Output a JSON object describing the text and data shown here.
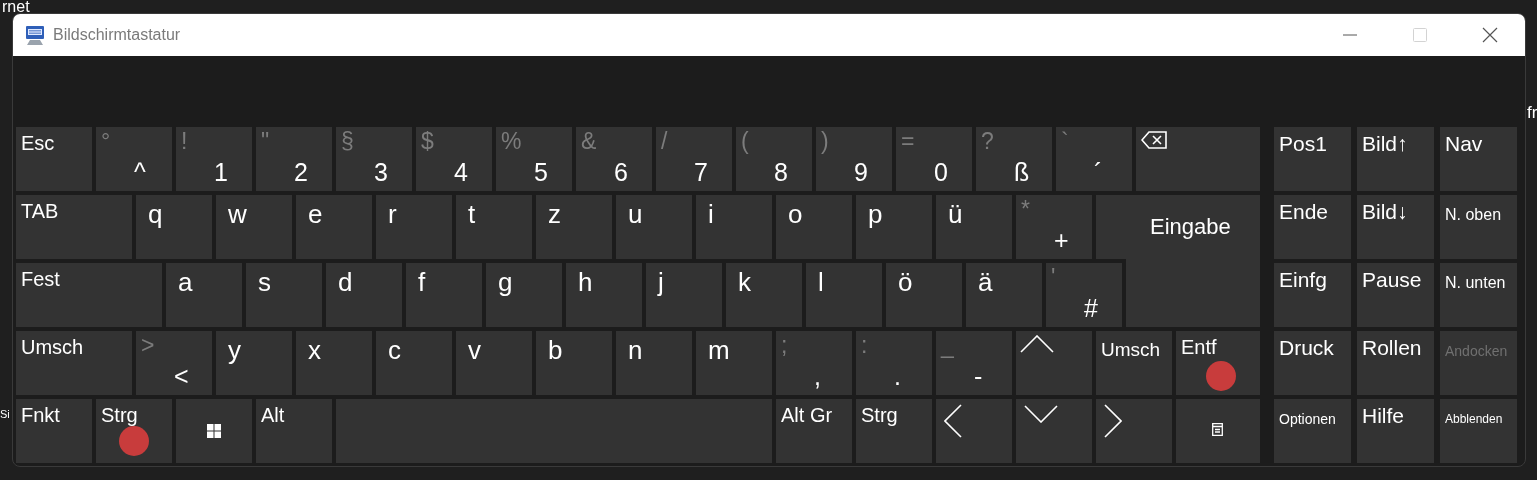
{
  "background_fragments": [
    "rnet",
    "Si",
    "fr"
  ],
  "window": {
    "title": "Bildschirmtastatur",
    "maximize_disabled": true
  },
  "keyboard": {
    "rows": [
      {
        "keys": [
          {
            "label": "Esc",
            "kind": "mod",
            "marked": false
          },
          {
            "shift": "°",
            "label": "^",
            "kind": "char",
            "marked": false
          },
          {
            "shift": "!",
            "label": "1",
            "kind": "char",
            "marked": false
          },
          {
            "shift": "\"",
            "label": "2",
            "kind": "char",
            "marked": false
          },
          {
            "shift": "§",
            "label": "3",
            "kind": "char",
            "marked": false
          },
          {
            "shift": "$",
            "label": "4",
            "kind": "char",
            "marked": false
          },
          {
            "shift": "%",
            "label": "5",
            "kind": "char",
            "marked": false
          },
          {
            "shift": "&",
            "label": "6",
            "kind": "char",
            "marked": false
          },
          {
            "shift": "/",
            "label": "7",
            "kind": "char",
            "marked": false
          },
          {
            "shift": "(",
            "label": "8",
            "kind": "char",
            "marked": false
          },
          {
            "shift": ")",
            "label": "9",
            "kind": "char",
            "marked": false
          },
          {
            "shift": "=",
            "label": "0",
            "kind": "char",
            "marked": false
          },
          {
            "shift": "?",
            "label": "ß",
            "kind": "char",
            "marked": false
          },
          {
            "shift": "`",
            "label": "´",
            "kind": "char",
            "marked": false
          },
          {
            "kind": "backspace",
            "marked": false
          }
        ]
      },
      {
        "keys": [
          {
            "label": "TAB",
            "kind": "tab",
            "marked": false
          },
          {
            "label": "q",
            "kind": "char",
            "marked": false
          },
          {
            "label": "w",
            "kind": "char",
            "marked": false
          },
          {
            "label": "e",
            "kind": "char",
            "marked": false
          },
          {
            "label": "r",
            "kind": "char",
            "marked": false
          },
          {
            "label": "t",
            "kind": "char",
            "marked": false
          },
          {
            "label": "z",
            "kind": "char",
            "marked": false
          },
          {
            "label": "u",
            "kind": "char",
            "marked": false
          },
          {
            "label": "i",
            "kind": "char",
            "marked": false
          },
          {
            "label": "o",
            "kind": "char",
            "marked": false
          },
          {
            "label": "p",
            "kind": "char",
            "marked": false
          },
          {
            "label": "ü",
            "kind": "char",
            "marked": false
          },
          {
            "shift": "*",
            "label": "+",
            "kind": "char",
            "marked": false
          },
          {
            "label": "Eingabe",
            "kind": "enter",
            "marked": false
          }
        ]
      },
      {
        "keys": [
          {
            "label": "Fest",
            "kind": "caps",
            "marked": false
          },
          {
            "label": "a",
            "kind": "char",
            "marked": false
          },
          {
            "label": "s",
            "kind": "char",
            "marked": false
          },
          {
            "label": "d",
            "kind": "char",
            "marked": false
          },
          {
            "label": "f",
            "kind": "char",
            "marked": false
          },
          {
            "label": "g",
            "kind": "char",
            "marked": false
          },
          {
            "label": "h",
            "kind": "char",
            "marked": false
          },
          {
            "label": "j",
            "kind": "char",
            "marked": false
          },
          {
            "label": "k",
            "kind": "char",
            "marked": false
          },
          {
            "label": "l",
            "kind": "char",
            "marked": false
          },
          {
            "label": "ö",
            "kind": "char",
            "marked": false
          },
          {
            "label": "ä",
            "kind": "char",
            "marked": false
          },
          {
            "shift": "'",
            "label": "#",
            "kind": "char",
            "marked": false
          }
        ]
      },
      {
        "keys": [
          {
            "label": "Umsch",
            "kind": "shift",
            "marked": false
          },
          {
            "shift": ">",
            "label": "<",
            "kind": "char",
            "marked": false
          },
          {
            "label": "y",
            "kind": "char",
            "marked": false
          },
          {
            "label": "x",
            "kind": "char",
            "marked": false
          },
          {
            "label": "c",
            "kind": "char",
            "marked": false
          },
          {
            "label": "v",
            "kind": "char",
            "marked": false
          },
          {
            "label": "b",
            "kind": "char",
            "marked": false
          },
          {
            "label": "n",
            "kind": "char",
            "marked": false
          },
          {
            "label": "m",
            "kind": "char",
            "marked": false
          },
          {
            "shift": ";",
            "label": ",",
            "kind": "char",
            "marked": false
          },
          {
            "shift": ":",
            "label": ".",
            "kind": "char",
            "marked": false
          },
          {
            "shift": "_",
            "label": "-",
            "kind": "char",
            "marked": false
          },
          {
            "kind": "arrow-up",
            "marked": false
          },
          {
            "label": "Umsch",
            "kind": "mod-small",
            "marked": false
          },
          {
            "label": "Entf",
            "kind": "delete",
            "marked": true
          }
        ]
      },
      {
        "keys": [
          {
            "label": "Fnkt",
            "kind": "mod",
            "marked": false
          },
          {
            "label": "Strg",
            "kind": "mod",
            "marked": true
          },
          {
            "kind": "windows",
            "marked": false
          },
          {
            "label": "Alt",
            "kind": "mod",
            "marked": false
          },
          {
            "kind": "space",
            "marked": false
          },
          {
            "label": "Alt Gr",
            "kind": "mod",
            "marked": false
          },
          {
            "label": "Strg",
            "kind": "mod",
            "marked": false
          },
          {
            "kind": "arrow-left",
            "marked": false
          },
          {
            "kind": "arrow-down",
            "marked": false
          },
          {
            "kind": "arrow-right",
            "marked": false
          },
          {
            "kind": "menu",
            "marked": false
          }
        ]
      }
    ],
    "nav_rows": [
      {
        "keys": [
          {
            "label": "Pos1",
            "kind": "nav",
            "disabled": false
          },
          {
            "label": "Bild↑",
            "kind": "nav",
            "disabled": false
          },
          {
            "label": "Nav",
            "kind": "nav",
            "disabled": false
          }
        ]
      },
      {
        "keys": [
          {
            "label": "Ende",
            "kind": "nav",
            "disabled": false
          },
          {
            "label": "Bild↓",
            "kind": "nav",
            "disabled": false
          },
          {
            "label": "N. oben",
            "kind": "nav-small",
            "disabled": false
          }
        ]
      },
      {
        "keys": [
          {
            "label": "Einfg",
            "kind": "nav",
            "disabled": false
          },
          {
            "label": "Pause",
            "kind": "nav",
            "disabled": false
          },
          {
            "label": "N. unten",
            "kind": "nav-small",
            "disabled": false
          }
        ]
      },
      {
        "keys": [
          {
            "label": "Druck",
            "kind": "nav",
            "disabled": false
          },
          {
            "label": "Rollen",
            "kind": "nav",
            "disabled": false
          },
          {
            "label": "Andocken",
            "kind": "nav-tiny",
            "disabled": true
          }
        ]
      },
      {
        "keys": [
          {
            "label": "Optionen",
            "kind": "nav-tiny",
            "disabled": false
          },
          {
            "label": "Hilfe",
            "kind": "nav",
            "disabled": false
          },
          {
            "label": "Abblenden",
            "kind": "nav-mini",
            "disabled": false
          }
        ]
      }
    ]
  }
}
